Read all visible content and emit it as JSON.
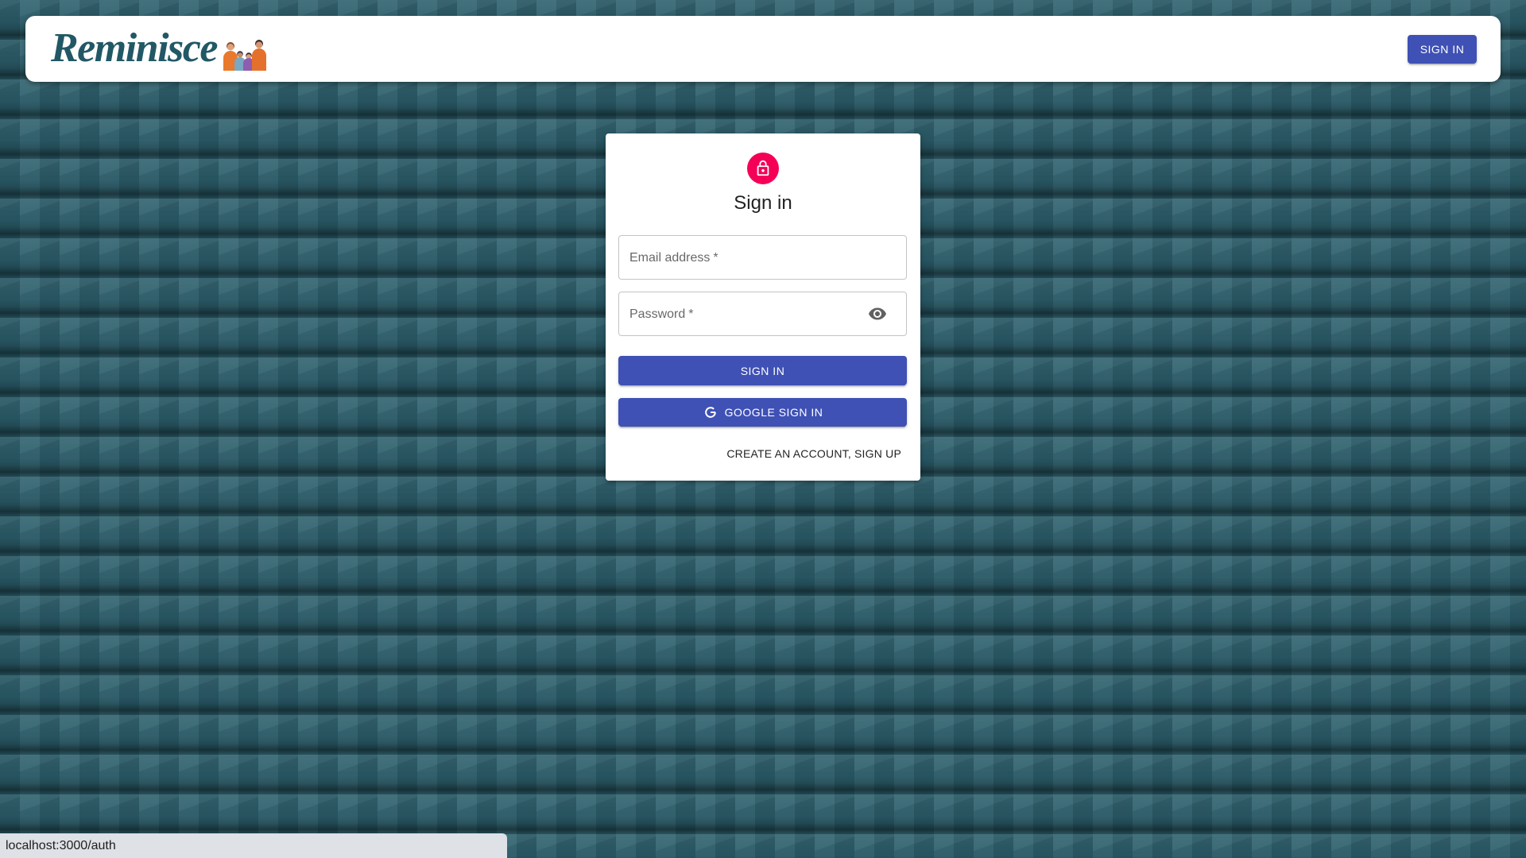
{
  "app": {
    "logo_text": "Reminisce"
  },
  "header": {
    "sign_in_label": "SIGN IN"
  },
  "auth_form": {
    "title": "Sign in",
    "email": {
      "label": "Email address",
      "required_mark": "*",
      "value": ""
    },
    "password": {
      "label": "Password",
      "required_mark": "*",
      "value": ""
    },
    "submit_label": "SIGN IN",
    "google_label": "GOOGLE SIGN IN",
    "switch_mode_label": "CREATE AN ACCOUNT, SIGN UP"
  },
  "status_bar": {
    "url": "localhost:3000/auth"
  },
  "icons": {
    "logo_illustration": "family-illustration-icon",
    "avatar": "lock-icon",
    "password_toggle": "eye-icon",
    "google": "google-g-icon"
  },
  "colors": {
    "primary": "#3f51b5",
    "secondary": "#f50057",
    "logo": "#225866",
    "background": "#2b5e6b"
  }
}
